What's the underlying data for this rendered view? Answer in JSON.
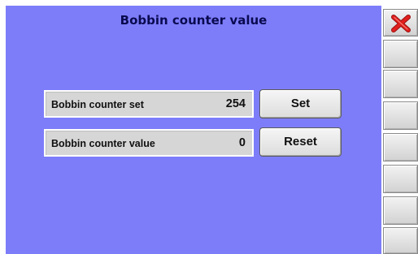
{
  "title": "Bobbin counter value",
  "fields": [
    {
      "label": "Bobbin counter set",
      "value": "254",
      "button": "Set"
    },
    {
      "label": "Bobbin counter value",
      "value": "0",
      "button": "Reset"
    }
  ],
  "sidebar": {
    "close_icon": "close-icon",
    "blank_button_count": 7
  },
  "colors": {
    "panel": "#7d7dfa",
    "title": "#0a0a50",
    "field": "#d6d6d6",
    "close_icon": "#e0201e"
  }
}
